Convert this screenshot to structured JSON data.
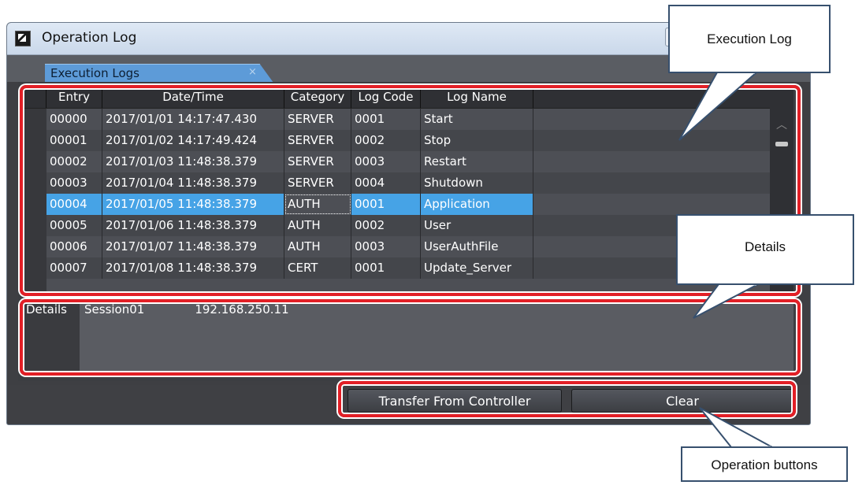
{
  "window": {
    "title": "Operation Log",
    "tab_label": "Execution Logs",
    "tab_close": "×"
  },
  "grid": {
    "columns": [
      "Entry",
      "Date/Time",
      "Category",
      "Log Code",
      "Log Name"
    ],
    "rows": [
      {
        "entry": "00000",
        "datetime": "2017/01/01 14:17:47.430",
        "category": "SERVER",
        "code": "0001",
        "name": "Start"
      },
      {
        "entry": "00001",
        "datetime": "2017/01/02 14:17:49.424",
        "category": "SERVER",
        "code": "0002",
        "name": "Stop"
      },
      {
        "entry": "00002",
        "datetime": "2017/01/03 11:48:38.379",
        "category": "SERVER",
        "code": "0003",
        "name": "Restart"
      },
      {
        "entry": "00003",
        "datetime": "2017/01/04 11:48:38.379",
        "category": "SERVER",
        "code": "0004",
        "name": "Shutdown"
      },
      {
        "entry": "00004",
        "datetime": "2017/01/05 11:48:38.379",
        "category": "AUTH",
        "code": "0001",
        "name": "Application"
      },
      {
        "entry": "00005",
        "datetime": "2017/01/06 11:48:38.379",
        "category": "AUTH",
        "code": "0002",
        "name": "User"
      },
      {
        "entry": "00006",
        "datetime": "2017/01/07 11:48:38.379",
        "category": "AUTH",
        "code": "0003",
        "name": "UserAuthFile"
      },
      {
        "entry": "00007",
        "datetime": "2017/01/08 11:48:38.379",
        "category": "CERT",
        "code": "0001",
        "name": "Update_Server"
      }
    ],
    "selected_entry": "00004"
  },
  "details": {
    "label": "Details",
    "session": "Session01",
    "ip": "192.168.250.11"
  },
  "buttons": {
    "transfer": "Transfer From Controller",
    "clear": "Clear"
  },
  "callouts": {
    "execution_log": "Execution Log",
    "details": "Details",
    "operation_buttons": "Operation buttons"
  },
  "colors": {
    "highlight": "#e21f26",
    "selection": "#46a3e6",
    "tab": "#5d9bd8"
  }
}
